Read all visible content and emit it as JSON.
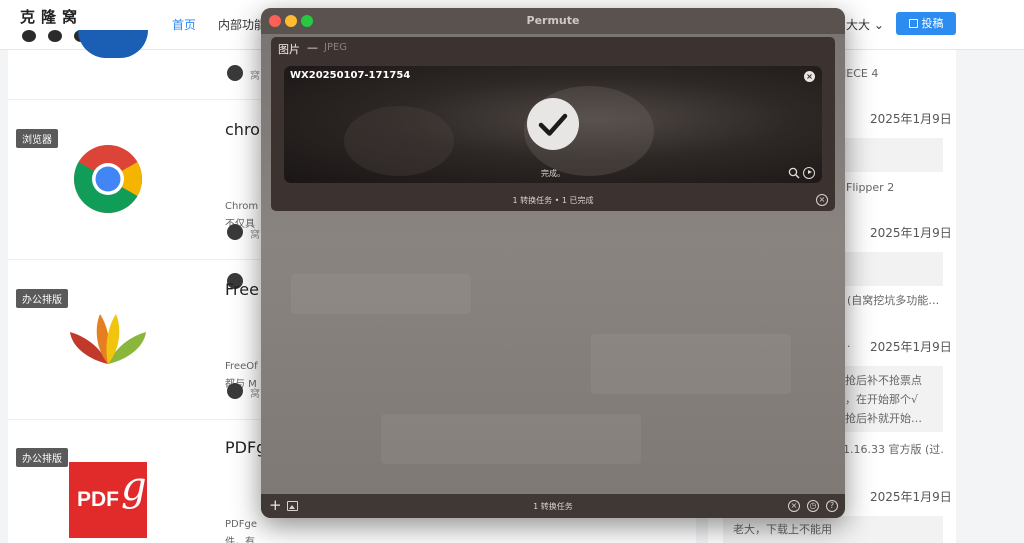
{
  "site": {
    "logo_text": "克隆窝",
    "nav": {
      "home": "首页",
      "inner": "内部功能"
    },
    "user": "大大",
    "post_button": "投稿"
  },
  "software": [
    {
      "category": "",
      "title": "",
      "desc": [
        "",
        ""
      ],
      "author": "窝"
    },
    {
      "category": "浏览器",
      "title": "chro",
      "desc": [
        "Chrom",
        "不仅具"
      ],
      "author": "窝"
    },
    {
      "category": "办公排版",
      "title": "Free",
      "desc": [
        "FreeOf",
        "都与 M"
      ],
      "author": "窝"
    },
    {
      "category": "办公排版",
      "title": "PDFg",
      "desc": [
        "PDFge",
        "件，有"
      ],
      "author": ""
    }
  ],
  "sidebar": {
    "items": [
      "IECE 4",
      "Flipper 2",
      "(自窝挖坑多功能…",
      ".",
      "抢后补不抢票点",
      "，在开始那个√",
      "抢后补就开始…",
      "1.16.33 官方版 (过…",
      "老大，下载上不能用"
    ],
    "dates": [
      "2025年1月9日",
      "2025年1月9日",
      "2025年1月9日",
      "2025年1月9日"
    ]
  },
  "permute": {
    "window_title": "Permute",
    "group": {
      "kind": "图片",
      "dash": "—",
      "format": "JPEG",
      "footer_count": "1 转换任务 • 1 已完成"
    },
    "file": {
      "name": "WX20250107-171754",
      "status": "完成。"
    },
    "footer_count": "1 转换任务"
  },
  "icons": {
    "window_close": "close-icon",
    "file_remove": "remove-file-icon",
    "done": "checkmark-icon",
    "reveal": "magnifier-icon",
    "open": "play-icon",
    "add": "plus-icon",
    "image": "image-icon",
    "clock": "clock-icon",
    "help": "help-icon"
  },
  "colors": {
    "accent_blue": "#2d8cf0",
    "traffic_red": "#fe5f57",
    "traffic_yellow": "#febc2e",
    "traffic_green": "#28c840"
  }
}
